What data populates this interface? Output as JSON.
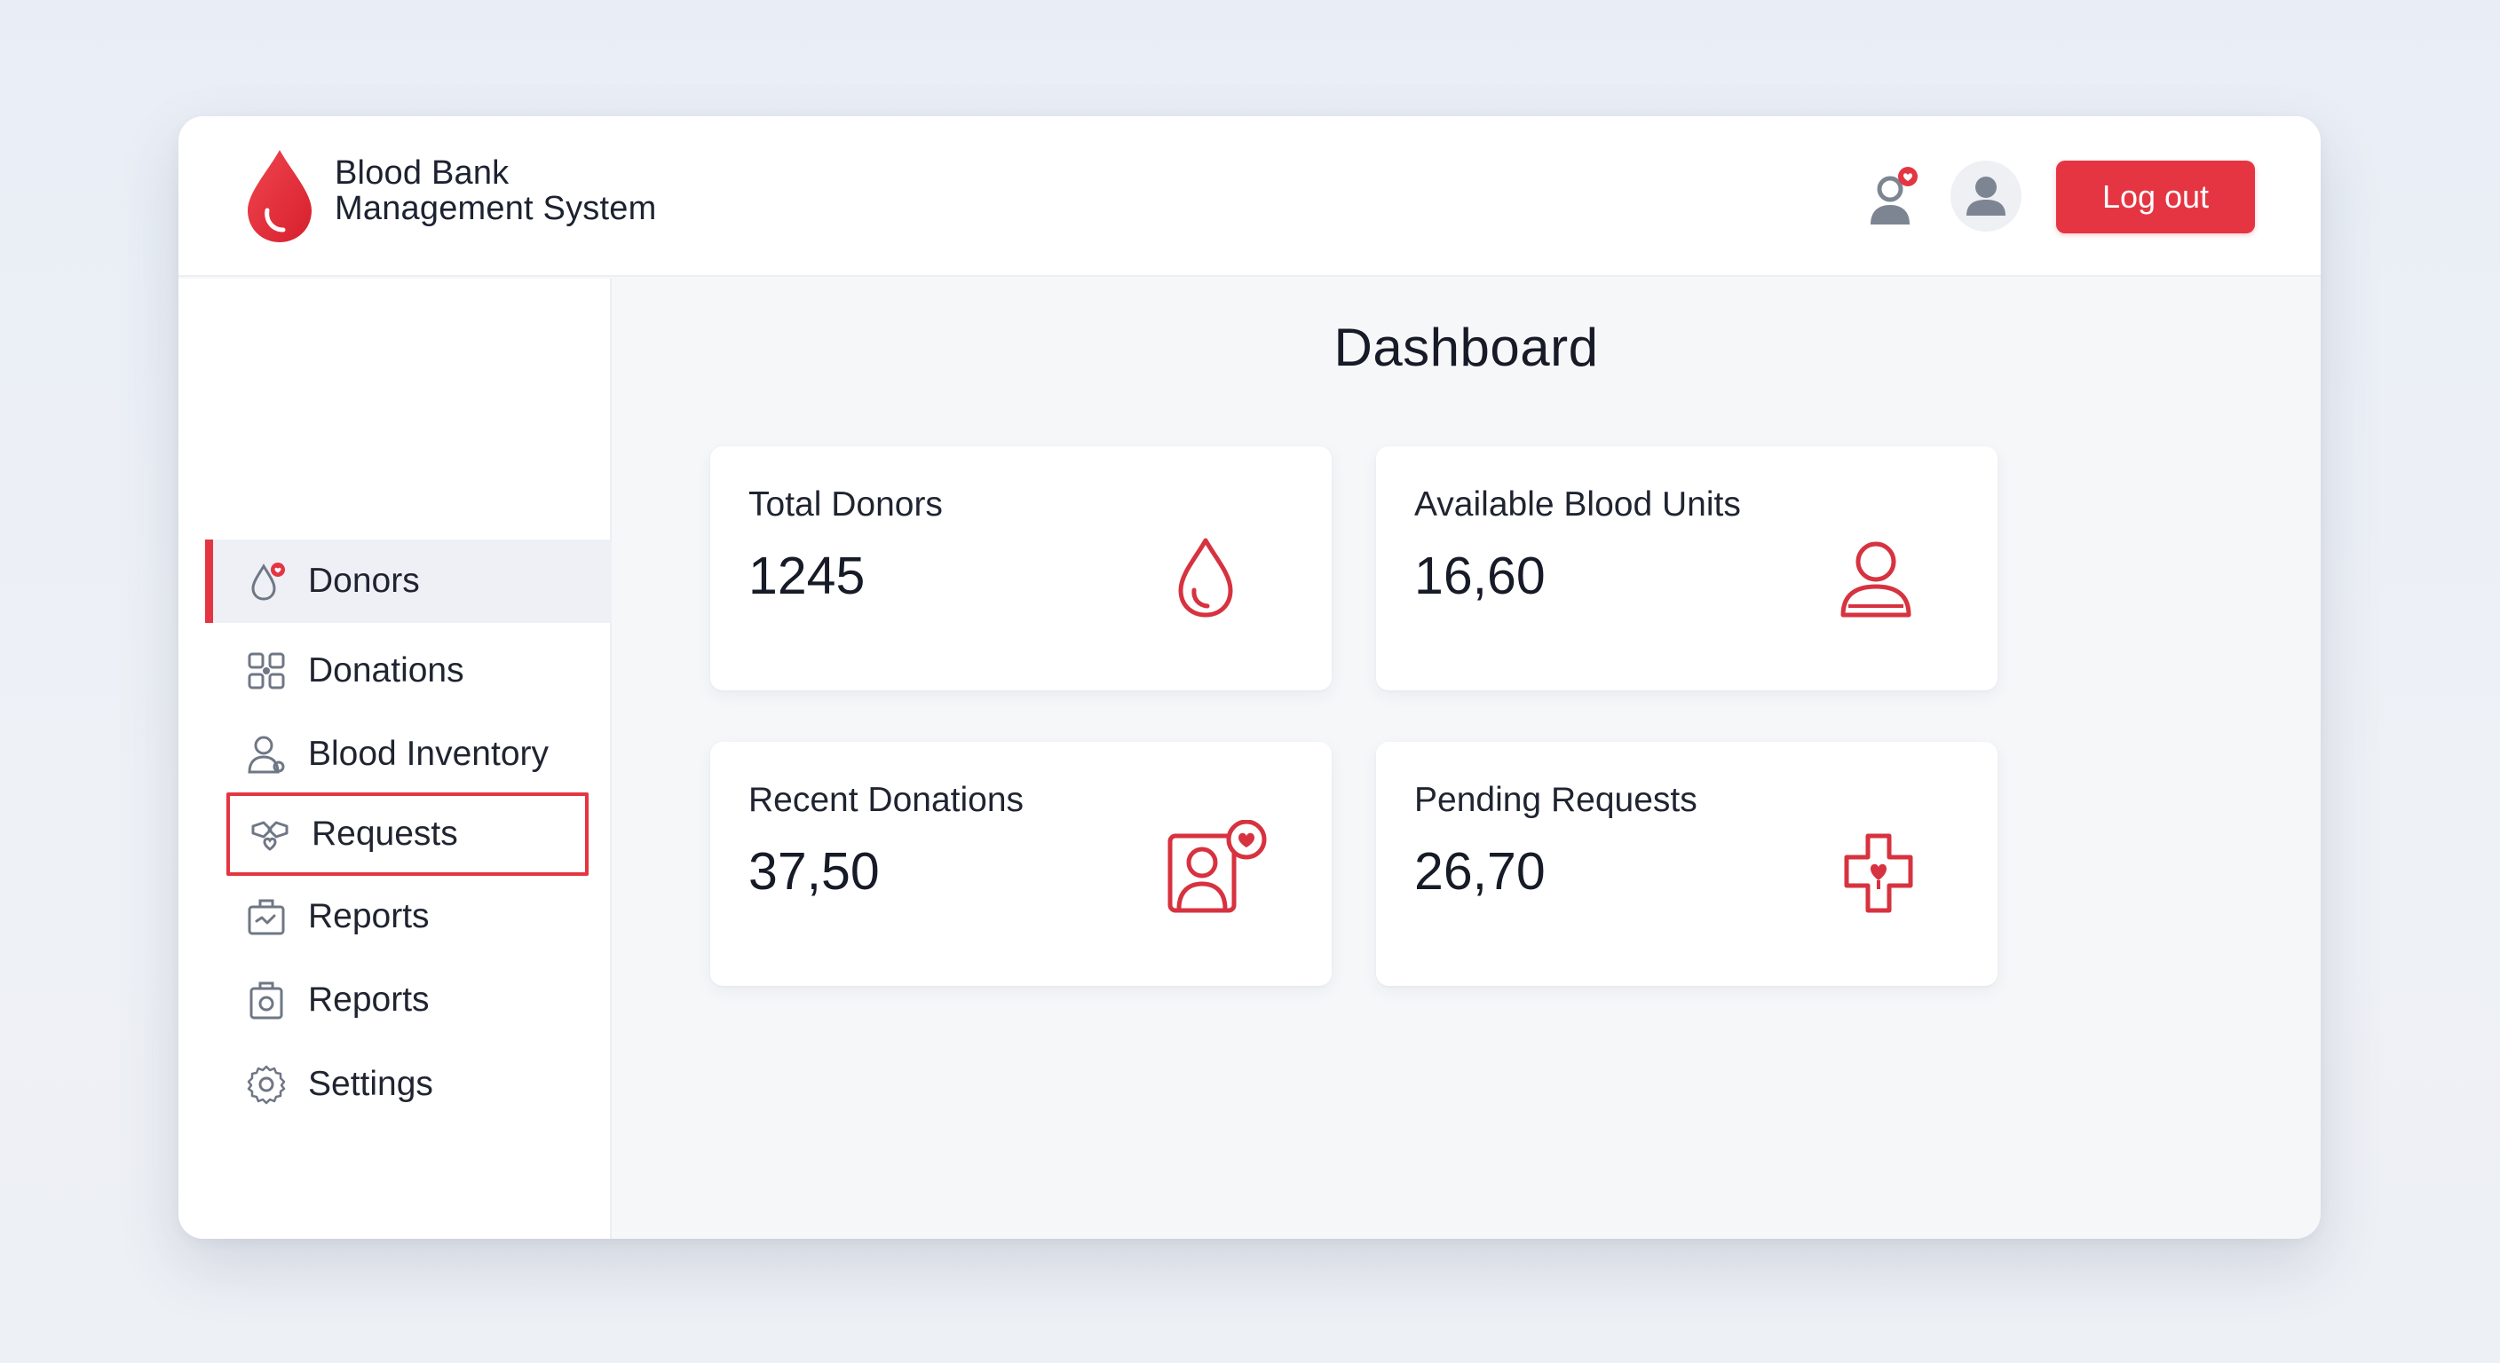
{
  "app": {
    "title_line1": "Blood Bank",
    "title_line2": "Management System",
    "brand_color": "#e53542"
  },
  "header": {
    "logout_label": "Log out",
    "icons": [
      "user-notification-icon",
      "avatar-icon"
    ]
  },
  "sidebar": {
    "items": [
      {
        "label": "Donors",
        "icon": "blood-drop-icon",
        "state": "active"
      },
      {
        "label": "Donations",
        "icon": "donations-grid-icon"
      },
      {
        "label": "Blood Inventory",
        "icon": "inventory-user-icon"
      },
      {
        "label": "Requests",
        "icon": "requests-hands-icon",
        "state": "highlighted"
      },
      {
        "label": "Reports",
        "icon": "reports-briefcase-icon"
      },
      {
        "label": "Reports",
        "icon": "reports-bag-icon"
      },
      {
        "label": "Settings",
        "icon": "gear-icon"
      }
    ]
  },
  "main": {
    "title": "Dashboard",
    "cards": [
      {
        "label": "Total Donors",
        "value": "1245",
        "icon": "blood-drop-icon"
      },
      {
        "label": "Available Blood Units",
        "value": "16,60",
        "icon": "user-icon"
      },
      {
        "label": "Recent Donations",
        "value": "37,50",
        "icon": "profile-heart-icon"
      },
      {
        "label": "Pending Requests",
        "value": "26,70",
        "icon": "medical-cross-heart-icon"
      }
    ]
  }
}
